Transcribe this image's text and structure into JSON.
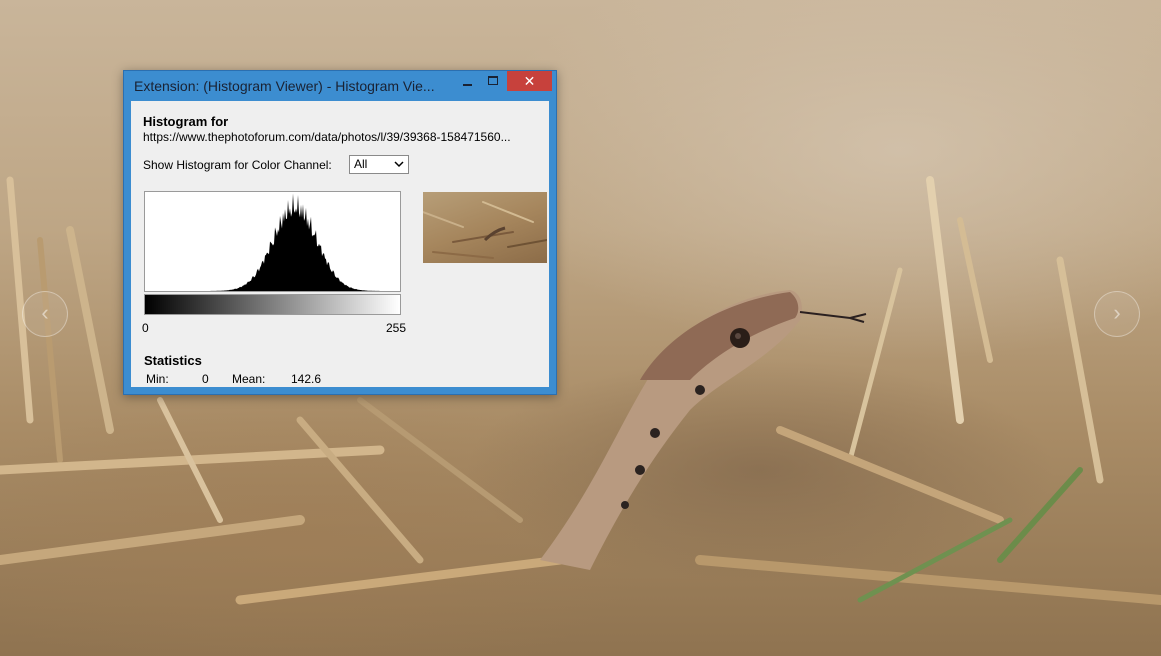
{
  "window": {
    "title": "Extension: (Histogram Viewer) - Histogram Vie...",
    "close_glyph": "✕"
  },
  "histogram": {
    "heading": "Histogram for",
    "url": "https://www.thephotoforum.com/data/photos/l/39/39368-158471560...",
    "channel_label": "Show Histogram for Color Channel:",
    "channel_selected": "All",
    "axis_min": "0",
    "axis_max": "255"
  },
  "statistics": {
    "title": "Statistics",
    "min_label": "Min:",
    "min_value": "0",
    "mean_label": "Mean:",
    "mean_value": "142.6"
  },
  "colors": {
    "title_bar": "#3c8dd0",
    "close_button": "#c7413c",
    "client_bg": "#efefef"
  },
  "icons": [
    "minimize-icon",
    "maximize-icon",
    "close-icon",
    "chevron-down-icon",
    "prev-arrow-icon",
    "next-arrow-icon"
  ]
}
